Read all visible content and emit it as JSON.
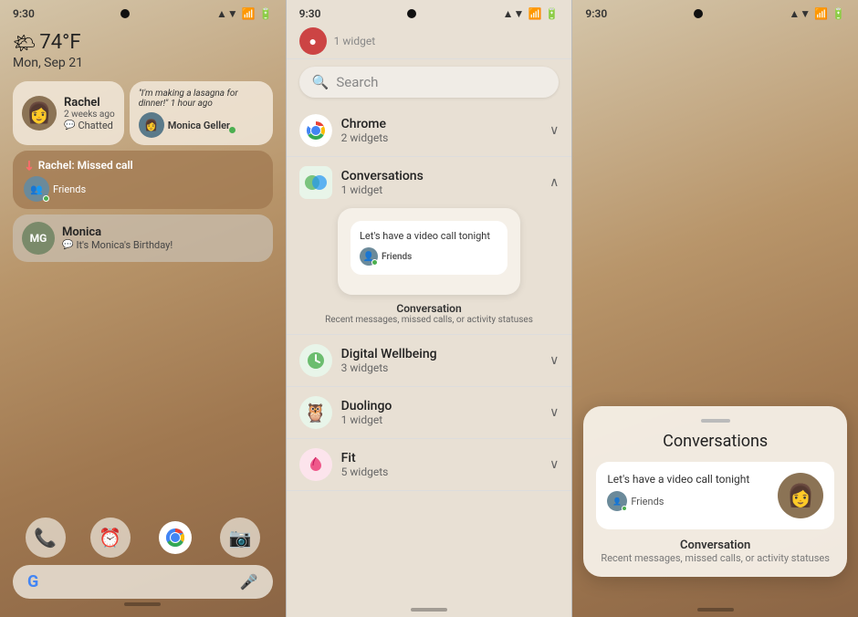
{
  "phones": {
    "phone1": {
      "status_bar": {
        "time": "9:30",
        "signal": "▲▼",
        "battery": "■"
      },
      "weather": {
        "icon": "🌤",
        "temp": "74°F",
        "date": "Mon, Sep 21"
      },
      "notifications": {
        "rachel": {
          "name": "Rachel",
          "time": "2 weeks ago",
          "action": "Chatted"
        },
        "monica_post": {
          "quote": "\"I'm making a lasagna for dinner!\" 1 hour ago",
          "name": "Monica Geller"
        },
        "missed_call": {
          "text": "Rachel: Missed call",
          "sub": "Friends"
        },
        "monica_bubble": {
          "initials": "MG",
          "name": "Monica",
          "text": "It's Monica's Birthday!"
        }
      },
      "dock": {
        "icons": [
          "📞",
          "⏰",
          "🌐",
          "📷"
        ],
        "search_placeholder": "G"
      }
    },
    "phone2": {
      "status_bar": {
        "time": "9:30"
      },
      "search": {
        "placeholder": "Search"
      },
      "partial_top": {
        "label": "1 widget"
      },
      "sections": [
        {
          "id": "chrome",
          "name": "Chrome",
          "count": "2 widgets",
          "expanded": false,
          "chevron": "∨"
        },
        {
          "id": "conversations",
          "name": "Conversations",
          "count": "1 widget",
          "expanded": true,
          "chevron": "∧"
        },
        {
          "id": "digital_wellbeing",
          "name": "Digital Wellbeing",
          "count": "3 widgets",
          "expanded": false,
          "chevron": "∨"
        },
        {
          "id": "duolingo",
          "name": "Duolingo",
          "count": "1 widget",
          "expanded": false,
          "chevron": "∨"
        },
        {
          "id": "fit",
          "name": "Fit",
          "count": "5 widgets",
          "expanded": false,
          "chevron": "∨"
        }
      ],
      "widget_preview": {
        "bubble_text": "Let's have a video call tonight",
        "friends_label": "Friends",
        "desc_name": "Conversation",
        "desc_text": "Recent messages, missed calls, or activity statuses"
      }
    },
    "phone3": {
      "status_bar": {
        "time": "9:30"
      },
      "panel": {
        "title": "Conversations",
        "widget": {
          "bubble_text": "Let's have a video call tonight",
          "friends_label": "Friends",
          "desc_name": "Conversation",
          "desc_text": "Recent messages, missed calls, or activity statuses"
        }
      }
    }
  }
}
